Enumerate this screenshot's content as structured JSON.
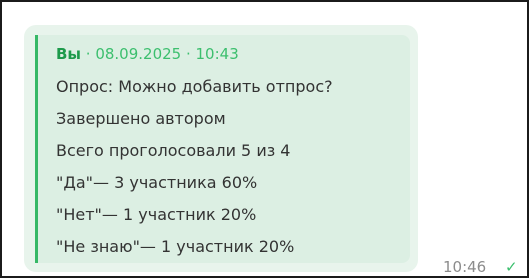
{
  "message": {
    "quote": {
      "author": "Вы",
      "separator": " · ",
      "date": "08.09.2025",
      "time": "10:43",
      "lines": [
        "Опрос: Можно добавить отпрос?",
        "Завершено автором",
        "Всего проголосовали 5 из 4",
        "\"Да\"— 3 участника 60%",
        "\"Нет\"— 1 участник 20%",
        "\"Не знаю\"— 1 участник 20%"
      ]
    },
    "time": "10:46",
    "status_icon": "check-icon"
  },
  "colors": {
    "bubble": "#e8f4ec",
    "quote_bar": "#36b866",
    "author": "#1d9a4b"
  }
}
